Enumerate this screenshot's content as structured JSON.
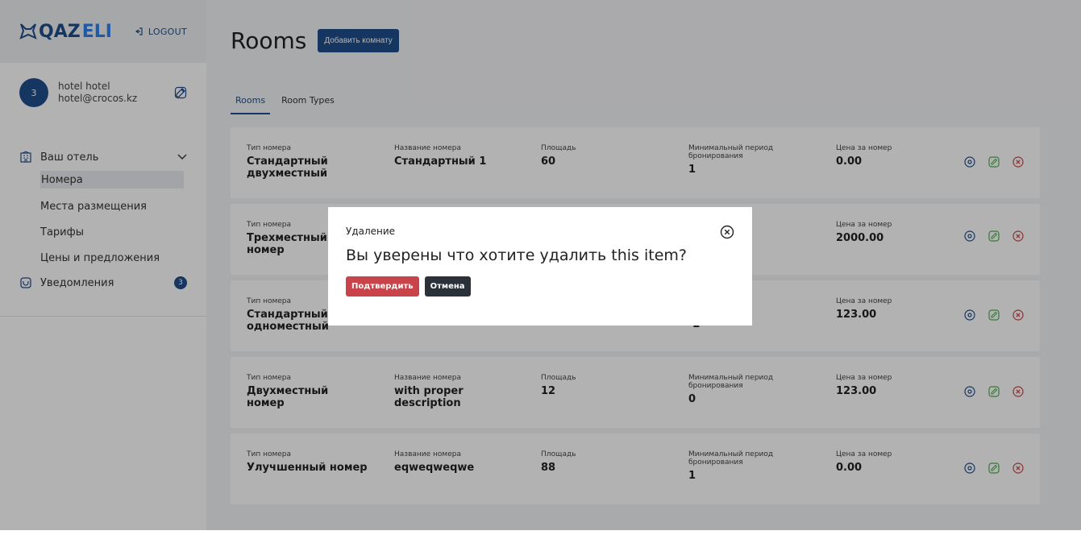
{
  "colors": {
    "primary": "#1f4e8c",
    "accent": "#2f80ed",
    "danger": "#c9444a",
    "success": "#4caf50",
    "dark": "#2b3138"
  },
  "brand": {
    "logo_q": "QAZ",
    "logo_eli": "ELI",
    "logout": "LOGOUT"
  },
  "user": {
    "avatar": "3",
    "name": "hotel hotel",
    "email": "hotel@crocos.kz"
  },
  "nav": {
    "hotel_group": "Ваш отель",
    "items": [
      "Номера",
      "Места размещения",
      "Тарифы",
      "Цены и предложения"
    ],
    "notifications": "Уведомления",
    "notifications_count": "3"
  },
  "page": {
    "title": "Rooms",
    "add_button": "Добавить комнату"
  },
  "tabs": [
    "Rooms",
    "Room Types"
  ],
  "columns": {
    "type": "Тип номера",
    "name": "Название номера",
    "area": "Площадь",
    "min_period": "Минимальный период бронирования",
    "price": "Цена за номер"
  },
  "rows": [
    {
      "type": "Стандартный двухместный",
      "name": "Стандартный 1",
      "area": "60",
      "min_period": "1",
      "price": "0.00"
    },
    {
      "type": "Трехместный номер",
      "name": "",
      "area": "",
      "min_period": "",
      "price": "2000.00"
    },
    {
      "type": "Стандартный одноместный",
      "name": "",
      "area": "",
      "min_period": "-2",
      "price": "123.00"
    },
    {
      "type": "Двухместный номер",
      "name": "with proper description",
      "area": "12",
      "min_period": "0",
      "price": "123.00"
    },
    {
      "type": "Улучшенный номер",
      "name": "eqweqweqwe",
      "area": "88",
      "min_period": "1",
      "price": "0.00"
    }
  ],
  "modal": {
    "title": "Удаление",
    "message": "Вы уверены что хотите удалить this item?",
    "confirm": "Подтвердить",
    "cancel": "Отмена"
  }
}
